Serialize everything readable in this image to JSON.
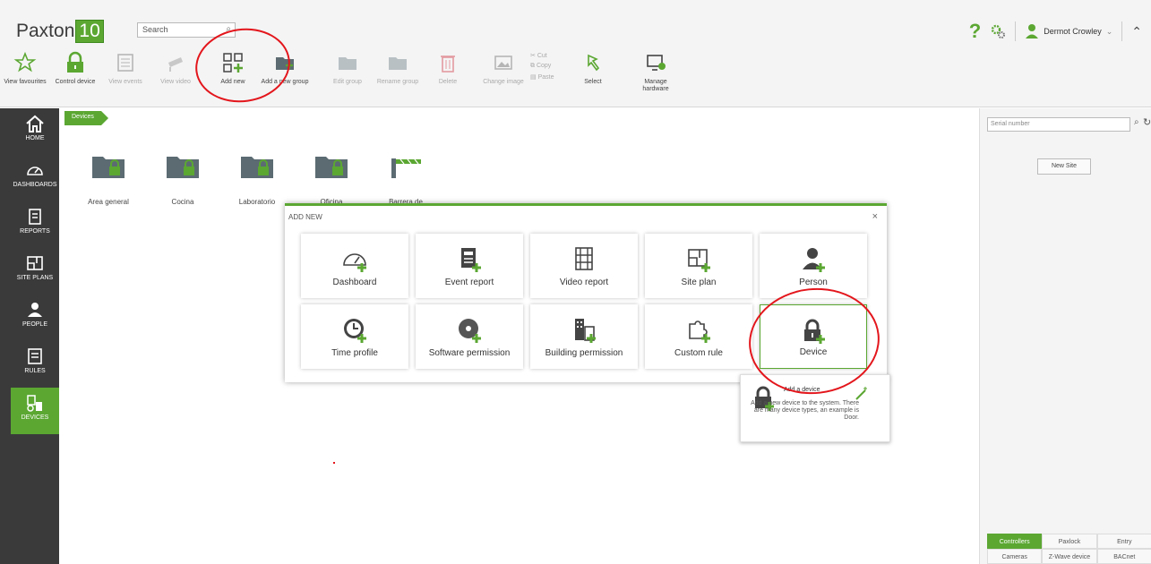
{
  "app": {
    "name": "Paxton",
    "version": "10"
  },
  "search": {
    "placeholder": "Search"
  },
  "toolbar": [
    {
      "label": "View favourites",
      "icon": "star-icon",
      "enabled": true
    },
    {
      "label": "Control device",
      "icon": "padlock-icon",
      "enabled": true
    },
    {
      "label": "View events",
      "icon": "events-icon",
      "enabled": false
    },
    {
      "label": "View video",
      "icon": "camera-icon",
      "enabled": false
    },
    {
      "label": "Add new",
      "icon": "add-new-icon",
      "enabled": true
    },
    {
      "label": "Add a new group",
      "icon": "add-group-icon",
      "enabled": true
    },
    {
      "label": "Edit group",
      "icon": "edit-group-icon",
      "enabled": false
    },
    {
      "label": "Rename group",
      "icon": "rename-group-icon",
      "enabled": false
    },
    {
      "label": "Delete",
      "icon": "trash-icon",
      "enabled": false
    },
    {
      "label": "Change image",
      "icon": "image-icon",
      "enabled": false
    },
    {
      "label": "Select",
      "icon": "select-icon",
      "enabled": true
    },
    {
      "label": "Manage hardware",
      "icon": "hardware-icon",
      "enabled": true
    }
  ],
  "clipboard": {
    "cut": "Cut",
    "copy": "Copy",
    "paste": "Paste"
  },
  "user": {
    "name": "Dermot Crowley"
  },
  "nav": [
    {
      "label": "HOME",
      "icon": "home-icon"
    },
    {
      "label": "DASHBOARDS",
      "icon": "dashboard-icon"
    },
    {
      "label": "REPORTS",
      "icon": "reports-icon"
    },
    {
      "label": "SITE PLANS",
      "icon": "site-plans-icon"
    },
    {
      "label": "PEOPLE",
      "icon": "people-icon"
    },
    {
      "label": "RULES",
      "icon": "rules-icon"
    },
    {
      "label": "DEVICES",
      "icon": "devices-icon",
      "active": true
    }
  ],
  "breadcrumb": "Devices",
  "folders": [
    {
      "label": "Area general"
    },
    {
      "label": "Cocina"
    },
    {
      "label": "Laboratorio"
    },
    {
      "label": "Oficina"
    },
    {
      "label": "Barrera de"
    }
  ],
  "dialog": {
    "title": "ADD NEW",
    "close": "×",
    "tiles": [
      {
        "label": "Dashboard",
        "icon": "dashboard-icon"
      },
      {
        "label": "Event report",
        "icon": "event-report-icon"
      },
      {
        "label": "Video report",
        "icon": "video-report-icon"
      },
      {
        "label": "Site plan",
        "icon": "site-plan-icon"
      },
      {
        "label": "Person",
        "icon": "person-icon"
      },
      {
        "label": "Time profile",
        "icon": "clock-icon"
      },
      {
        "label": "Software permission",
        "icon": "disc-icon"
      },
      {
        "label": "Building permission",
        "icon": "building-icon"
      },
      {
        "label": "Custom rule",
        "icon": "puzzle-icon"
      },
      {
        "label": "Device",
        "icon": "padlock-icon"
      }
    ]
  },
  "tooltip": {
    "title": "Add a device",
    "description": "Add a new device to the system. There are many device types, an example is Door."
  },
  "right_panel": {
    "serial_placeholder": "Serial number",
    "new_site": "New Site",
    "tabs_row1": [
      "Controllers",
      "Paxlock",
      "Entry"
    ],
    "tabs_row2": [
      "Cameras",
      "Z-Wave device",
      "BACnet"
    ]
  },
  "colors": {
    "accent": "#5ba732",
    "annotation": "#e3161c",
    "nav_bg": "#3a3a3a"
  }
}
